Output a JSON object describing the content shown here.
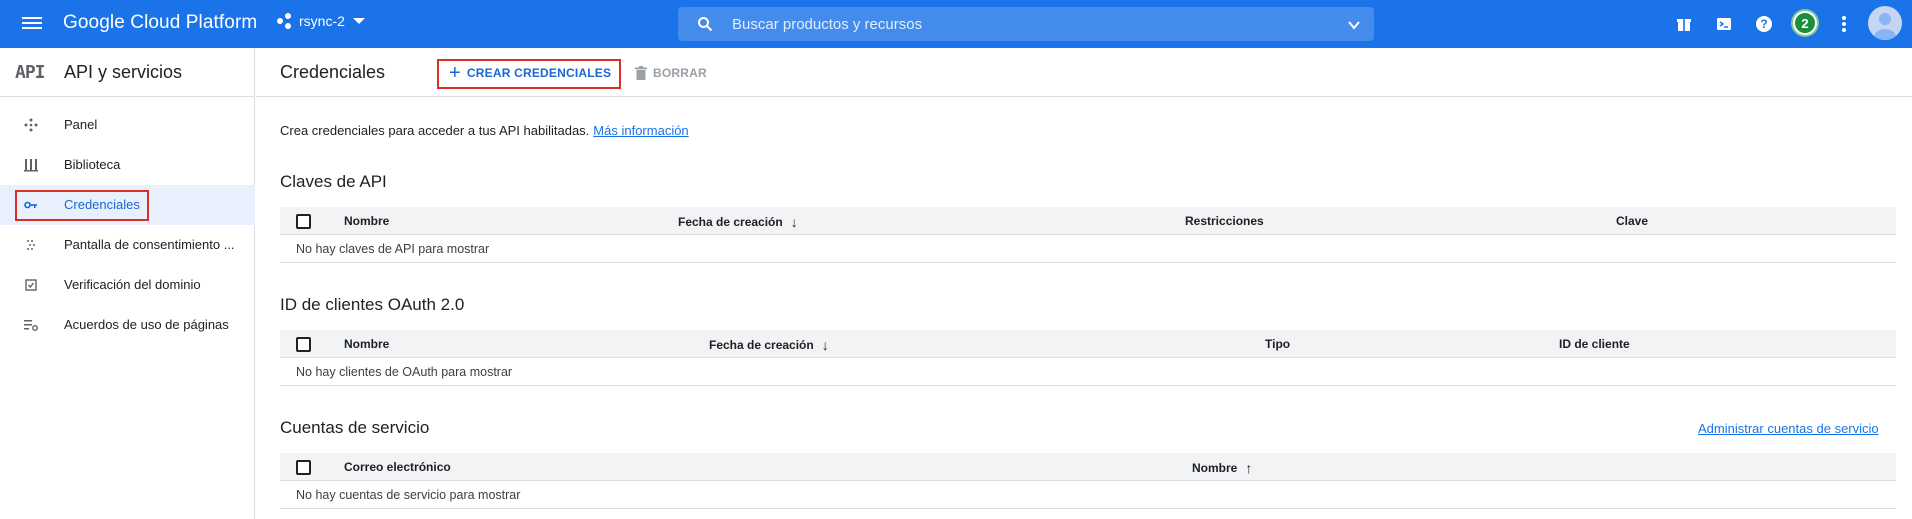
{
  "topbar": {
    "brand": "Google Cloud Platform",
    "project": "rsync-2",
    "search_placeholder": "Buscar productos y recursos",
    "notification_count": "2",
    "icons": [
      "gift-icon",
      "terminal-icon",
      "help-icon",
      "more-vert-icon"
    ]
  },
  "sidebar": {
    "logo": "API",
    "title": "API y servicios",
    "items": [
      {
        "label": "Panel",
        "icon": "dashboard-icon"
      },
      {
        "label": "Biblioteca",
        "icon": "library-icon"
      },
      {
        "label": "Credenciales",
        "icon": "key-icon",
        "active": true
      },
      {
        "label": "Pantalla de consentimiento ...",
        "icon": "consent-icon"
      },
      {
        "label": "Verificación del dominio",
        "icon": "domain-check-icon"
      },
      {
        "label": "Acuerdos de uso de páginas",
        "icon": "settings-list-icon"
      }
    ]
  },
  "header": {
    "title": "Credenciales",
    "create_label": "CREAR CREDENCIALES",
    "delete_label": "BORRAR"
  },
  "intro": {
    "text": "Crea credenciales para acceder a tus API habilitadas.",
    "link": "Más información"
  },
  "sections": {
    "api_keys": {
      "title": "Claves de API",
      "columns": [
        "Nombre",
        "Fecha de creación",
        "Restricciones",
        "Clave"
      ],
      "empty": "No hay claves de API para mostrar"
    },
    "oauth": {
      "title": "ID de clientes OAuth 2.0",
      "columns": [
        "Nombre",
        "Fecha de creación",
        "Tipo",
        "ID de cliente"
      ],
      "empty": "No hay clientes de OAuth para mostrar"
    },
    "service_accounts": {
      "title": "Cuentas de servicio",
      "manage_link": "Administrar cuentas de servicio",
      "columns": [
        "Correo electrónico",
        "Nombre"
      ],
      "empty": "No hay cuentas de servicio para mostrar"
    }
  },
  "colors": {
    "primary": "#1a73e8",
    "highlight": "#d93025",
    "active_bg": "#e8f0fe"
  }
}
